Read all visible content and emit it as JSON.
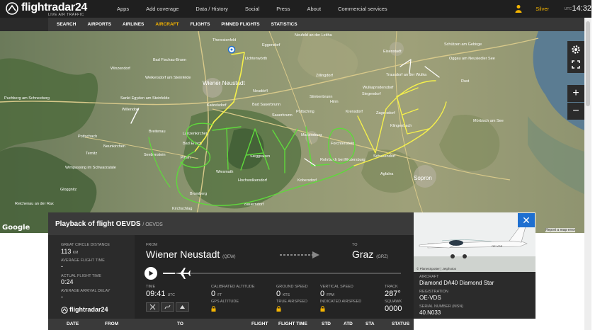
{
  "header": {
    "logo_text": "flightradar24",
    "logo_sub": "LIVE AIR TRAFFIC",
    "nav": [
      "Apps",
      "Add coverage",
      "Data / History",
      "Social",
      "Press",
      "About",
      "Commercial services"
    ],
    "user": "Silver",
    "utc_label": "UTC",
    "time": "14:32"
  },
  "subnav": {
    "items": [
      "SEARCH",
      "AIRPORTS",
      "AIRLINES",
      "AIRCRAFT",
      "FLIGHTS",
      "PINNED FLIGHTS",
      "STATISTICS"
    ],
    "active": "AIRCRAFT"
  },
  "map": {
    "places": [
      "Theresienfeld",
      "Eggendorf",
      "Neufeld an der Leitha",
      "Eisenstadt",
      "Wiener Neustadt",
      "Zillingdorf",
      "Katzelsdorf",
      "Lanzenkirchen",
      "Bad Erlach",
      "Mattersburg",
      "Sauerbrunn",
      "Schattendorf",
      "Sopron",
      "Kobersdorf",
      "Agfalva",
      "Klingenbach",
      "Zagersdorf",
      "Siegendorf",
      "Wulkaprodersdorf",
      "Trausdorf an der Wulka",
      "Schützen am Gebirge",
      "Oggau am Neusiedler See",
      "Rust",
      "Mörbisch am See",
      "Neunkirchen",
      "Ternitz",
      "Pitten",
      "Seebenstein",
      "Breitenau",
      "Willendorf",
      "Sankt Egyden am Steinfelde",
      "Weikersdorf am Steinfelde",
      "Bad Fischau-Brunn",
      "Winzendorf",
      "Pottschach",
      "Wimpassing im Schwarzatale",
      "Gloggnitz",
      "Reichenau an der Rax",
      "Puchberg am Schneeberg",
      "Bromberg",
      "Kirchschlag",
      "Hochwolkersdorf",
      "Wiesmath",
      "Bauerndorf",
      "Lichtenwörth",
      "Sieggraben",
      "Forchtenstein",
      "Rohrbach bei Mattersburg",
      "Krensdorf",
      "Hirm",
      "Stinkenbrunn",
      "Pöttsching",
      "Bad Sauerbrunn",
      "Neudörfl"
    ],
    "controls": {
      "settings": "gear-icon",
      "fullscreen": "fullscreen-icon",
      "zoom_in": "+",
      "zoom_out": "−"
    },
    "attribution": "Report a map error",
    "google": "Google",
    "track_colors": {
      "track": "#5fd93c",
      "highlight": "#f5f04b",
      "end": "#ffffff"
    }
  },
  "panel": {
    "title": "Playback of flight OEVDS",
    "subtitle": "/ OEVDS",
    "great_circle_label": "GREAT CIRCLE DISTANCE",
    "great_circle_value": "113",
    "great_circle_unit": "KM",
    "avg_flight_time_label": "AVERAGE FLIGHT TIME",
    "avg_flight_time_value": "-",
    "actual_flight_time_label": "ACTUAL FLIGHT TIME",
    "actual_flight_time_value": "0:24",
    "avg_arrival_delay_label": "AVERAGE ARRIVAL DELAY",
    "avg_arrival_delay_value": "-",
    "brand": "flightradar24",
    "from_label": "FROM",
    "from_city": "Wiener Neustadt",
    "from_code": "(QEW)",
    "to_label": "TO",
    "to_city": "Graz",
    "to_code": "(GRZ)",
    "progress": 0.05,
    "time_label": "TIME",
    "time_value": "09:41",
    "time_unit": "UTC",
    "cal_alt_label": "CALIBRATED ALTITUDE",
    "cal_alt_value": "0",
    "cal_alt_unit": "FT",
    "gps_alt_label": "GPS ALTITUDE",
    "ground_speed_label": "GROUND SPEED",
    "ground_speed_value": "0",
    "ground_speed_unit": "KTS",
    "true_airspeed_label": "TRUE AIRSPEED",
    "vertical_speed_label": "VERTICAL SPEED",
    "vertical_speed_value": "0",
    "vertical_speed_unit": "FPM",
    "indicated_airspeed_label": "INDICATED AIRSPEED",
    "track_label": "TRACK",
    "track_value": "287°",
    "squawk_label": "SQUAWK",
    "squawk_value": "0000"
  },
  "aircraft": {
    "photo_credit": "© PlanesSpotter | Jetphotos",
    "aircraft_label": "AIRCRAFT",
    "aircraft_value": "Diamond DA40 Diamond Star",
    "registration_label": "REGISTRATION",
    "registration_value": "OE-VDS",
    "serial_label": "SERIAL NUMBER (MSN)",
    "serial_value": "40.N033",
    "close": "✕"
  },
  "table_header": [
    "DATE",
    "FROM",
    "TO",
    "FLIGHT",
    "FLIGHT TIME",
    "STD",
    "ATD",
    "STA",
    "STATUS"
  ]
}
